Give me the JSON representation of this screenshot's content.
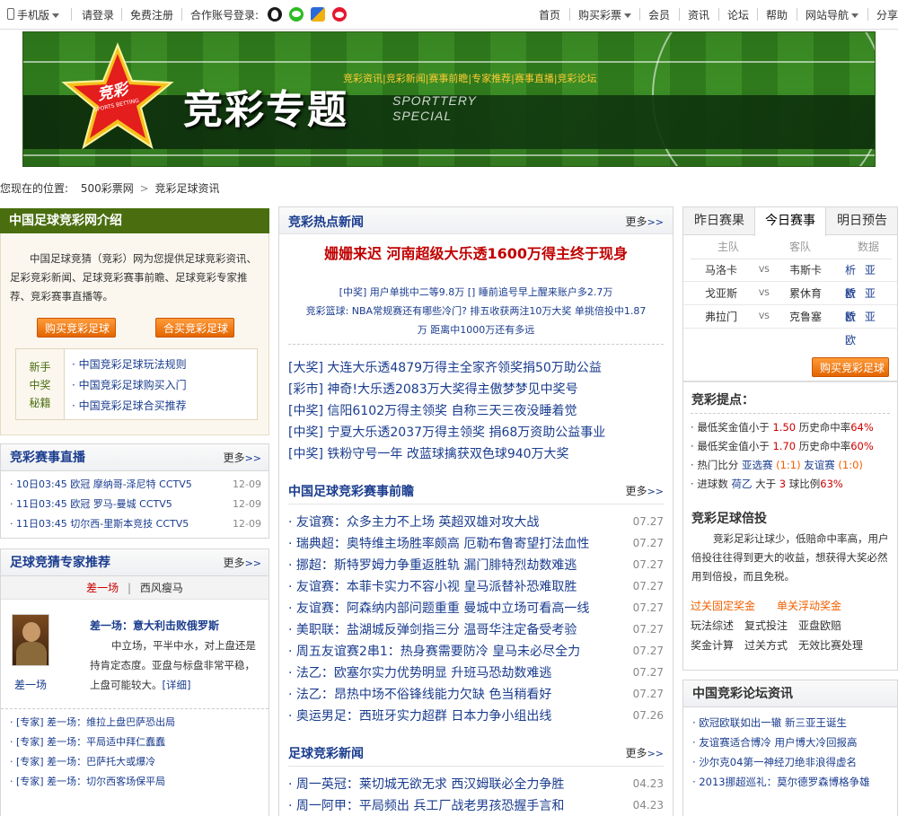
{
  "topbar": {
    "mobile": "手机版",
    "login": "请登录",
    "register": "免费注册",
    "partner_login": "合作账号登录:",
    "nav": [
      "首页",
      "购买彩票",
      "会员",
      "资讯",
      "论坛",
      "帮助",
      "网站导航",
      "分享"
    ]
  },
  "banner": {
    "logo_text": "竞彩",
    "logo_sub": "SPORTS BETTING",
    "title": "竞彩专题",
    "subtitle_line1": "SPORTTERY",
    "subtitle_line2": "SPECIAL",
    "links": "竞彩资讯|竞彩新闻|赛事前瞻|专家推荐|赛事直播|竞彩论坛"
  },
  "breadcrumb": {
    "prefix": "您现在的位置:",
    "home": "500彩票网",
    "sep": ">",
    "current": "竞彩足球资讯"
  },
  "intro": {
    "title": "中国足球竞彩网介绍",
    "text": "中国足球竞猜（竞彩）网为您提供足球竞彩资讯、足彩竞彩新闻、足球竞彩赛事前瞻、足球竞彩专家推荐、竞彩赛事直播等。",
    "buy_button": "购买竞彩足球",
    "group_button": "合买竞彩足球",
    "side_label": [
      "新手",
      "中奖",
      "秘籍"
    ],
    "links": [
      "中国竞彩足球玩法规则",
      "中国竞彩足球购买入门",
      "中国竞彩足球合买推荐"
    ]
  },
  "live": {
    "title": "竞彩赛事直播",
    "more": "更多",
    "rows": [
      {
        "text": "10日03:45 欧冠  摩纳哥-泽尼特  CCTV5",
        "date": "12-09"
      },
      {
        "text": "11日03:45 欧冠  罗马-曼城  CCTV5",
        "date": "12-09"
      },
      {
        "text": "11日03:45  切尔西-里斯本竞技  CCTV5",
        "date": "12-09"
      }
    ]
  },
  "expert": {
    "title": "足球竞猜专家推荐",
    "more": "更多",
    "tab_active": "差一场",
    "tab_other": "西风瘦马",
    "name": "差一场",
    "headline": "差一场：意大利击败俄罗斯",
    "text": "中立场，平半中水，对上盘还是持肯定态度。亚盘与标盘非常平稳，上盘可能较大。",
    "detail": "[详细]",
    "rows": [
      "[专家] 差一场：维拉上盘巴萨恐出局",
      "[专家] 差一场：平局适中拜仁蠢蠢",
      "[专家] 差一场：巴萨托大或爆冷",
      "[专家] 差一场：切尔西客场保平局"
    ]
  },
  "hot": {
    "title": "竞彩热点新闻",
    "more": "更多",
    "headline": "姗姗来迟 河南超级大乐透1600万得主终于现身",
    "small": [
      "[中奖] 用户单挑中二等9.8万  [] 睡前追号早上醒来账户多2.7万",
      "竞彩篮球: NBA常规赛还有哪些冷门?  排五收获两注10万大奖 单挑倍投中1.87",
      "万 距离中1000万还有多远"
    ],
    "list": [
      "[大奖] 大连大乐透4879万得主全家齐领奖捐50万助公益",
      "[彩市] 神奇!大乐透2083万大奖得主傲梦梦见中奖号",
      "[中奖] 信阳6102万得主领奖 自称三天三夜没睡着觉",
      "[中奖] 宁夏大乐透2037万得主领奖 捐68万资助公益事业",
      "[中奖] 铁粉守号一年 改蓝球擒获双色球940万大奖"
    ]
  },
  "preview": {
    "title": "中国足球竞彩赛事前瞻",
    "more": "更多",
    "rows": [
      {
        "text": "友谊赛：众多主力不上场 英超双雄对攻大战",
        "date": "07.27"
      },
      {
        "text": "瑞典超：奥特维主场胜率颇高 厄勒布鲁寄望打法血性",
        "date": "07.27"
      },
      {
        "text": "挪超：斯特罗姆力争重返胜轨 漏门腓特烈劫数难逃",
        "date": "07.27"
      },
      {
        "text": "友谊赛：本菲卡实力不容小视 皇马派替补恐难取胜",
        "date": "07.27"
      },
      {
        "text": "友谊赛：阿森纳内部问题重重 曼城中立场可看高一线",
        "date": "07.27"
      },
      {
        "text": "美职联：盐湖城反弹剑指三分 温哥华注定备受考验",
        "date": "07.27"
      },
      {
        "text": "周五友谊赛2串1：热身赛需要防冷 皇马未必尽全力",
        "date": "07.27"
      },
      {
        "text": "法乙：欧塞尔实力优势明显 升班马恐劫数难逃",
        "date": "07.27"
      },
      {
        "text": "法乙：昂热中场不俗锋线能力欠缺 色当稍看好",
        "date": "07.27"
      },
      {
        "text": "奥运男足：西班牙实力超群 日本力争小组出线",
        "date": "07.26"
      }
    ]
  },
  "news": {
    "title": "足球竞彩新闻",
    "more": "更多",
    "rows": [
      {
        "text": "周一英冠：莱切城无欲无求 西汉姆联必全力争胜",
        "date": "04.23"
      },
      {
        "text": "周一阿甲：平局频出 兵工厂战老男孩恐握手言和",
        "date": "04.23"
      }
    ]
  },
  "matches": {
    "tabs": [
      "昨日赛果",
      "今日赛事",
      "明日预告"
    ],
    "active_tab": 1,
    "headers": [
      "主队",
      "客队",
      "数据"
    ],
    "rows": [
      {
        "home": "马洛卡",
        "vs": "VS",
        "away": "韦斯卡",
        "data": "析 亚 欧"
      },
      {
        "home": "戈亚斯",
        "vs": "VS",
        "away": "累休育",
        "data": "析 亚 欧"
      },
      {
        "home": "弗拉门",
        "vs": "VS",
        "away": "克鲁塞",
        "data": "析 亚 欧"
      }
    ],
    "buy_button": "购买竞彩足球"
  },
  "tips": {
    "title": "竞彩提点：",
    "rows": [
      {
        "a": "最低奖金值小于",
        "b": "1.50",
        "c": "历史命中率",
        "d": "64%"
      },
      {
        "a": "最低奖金值小于",
        "b": "1.70",
        "c": "历史命中率",
        "d": "60%"
      },
      {
        "a": "热门比分",
        "b": "亚选赛",
        "b2": "(1:1)",
        "c": "友谊赛",
        "d": "(1:0)"
      },
      {
        "a": "进球数",
        "b": "荷乙",
        "c": "大于",
        "b3": "3",
        "c2": "球比例",
        "d": "63%"
      }
    ]
  },
  "multiply": {
    "title": "竞彩足球倍投",
    "text": "竞彩足彩让球少，低赔命中率高，用户倍投往往得到更大的收益，想获得大奖必然用到倍投，而且免税。"
  },
  "tools": {
    "row1": [
      "过关固定奖金",
      "单关浮动奖金"
    ],
    "row2": [
      "玩法综述",
      "复式投注",
      "亚盘欧赔"
    ],
    "row3": [
      "奖金计算",
      "过关方式",
      "无效比赛处理"
    ]
  },
  "forum": {
    "title": "中国竞彩论坛资讯",
    "rows": [
      "欧冠欧联如出一辙 新三亚王诞生",
      "友谊赛适合博冷 用户博大冷回报高",
      "沙尔克04第一神经刀绝非浪得虚名",
      "2013挪超巡礼：莫尔德罗森博格争雄"
    ]
  },
  "colors": {
    "link_blue": "#1a3c8e",
    "headline_red": "#c00000",
    "accent_orange": "#f06000",
    "intro_green": "#4a6e0f"
  }
}
